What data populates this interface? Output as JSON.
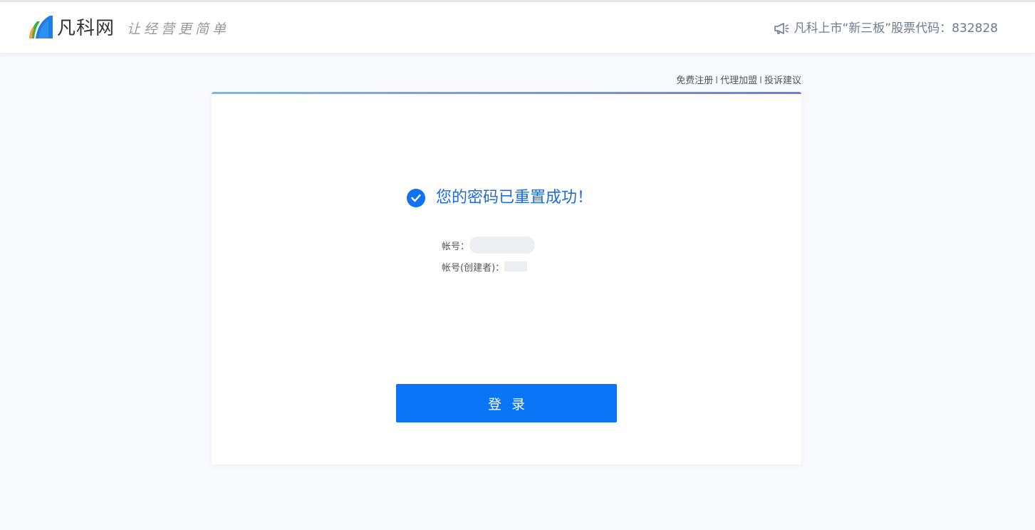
{
  "header": {
    "brand": "凡科网",
    "slogan": "让经营更简单",
    "notice": "凡科上市“新三板”股票代码：832828"
  },
  "top_links": {
    "register": "免费注册",
    "agent": "代理加盟",
    "complaint": "投诉建议",
    "separator": "I"
  },
  "result": {
    "message": "您的密码已重置成功！",
    "account_label": "帐号：",
    "creator_label": "帐号(创建者)："
  },
  "login_button": "登录",
  "colors": {
    "primary": "#0a74f6",
    "success_text": "#1a6ce0",
    "background": "#f7f9fc"
  },
  "icons": [
    "logo-icon",
    "megaphone-icon",
    "check-circle-icon"
  ]
}
